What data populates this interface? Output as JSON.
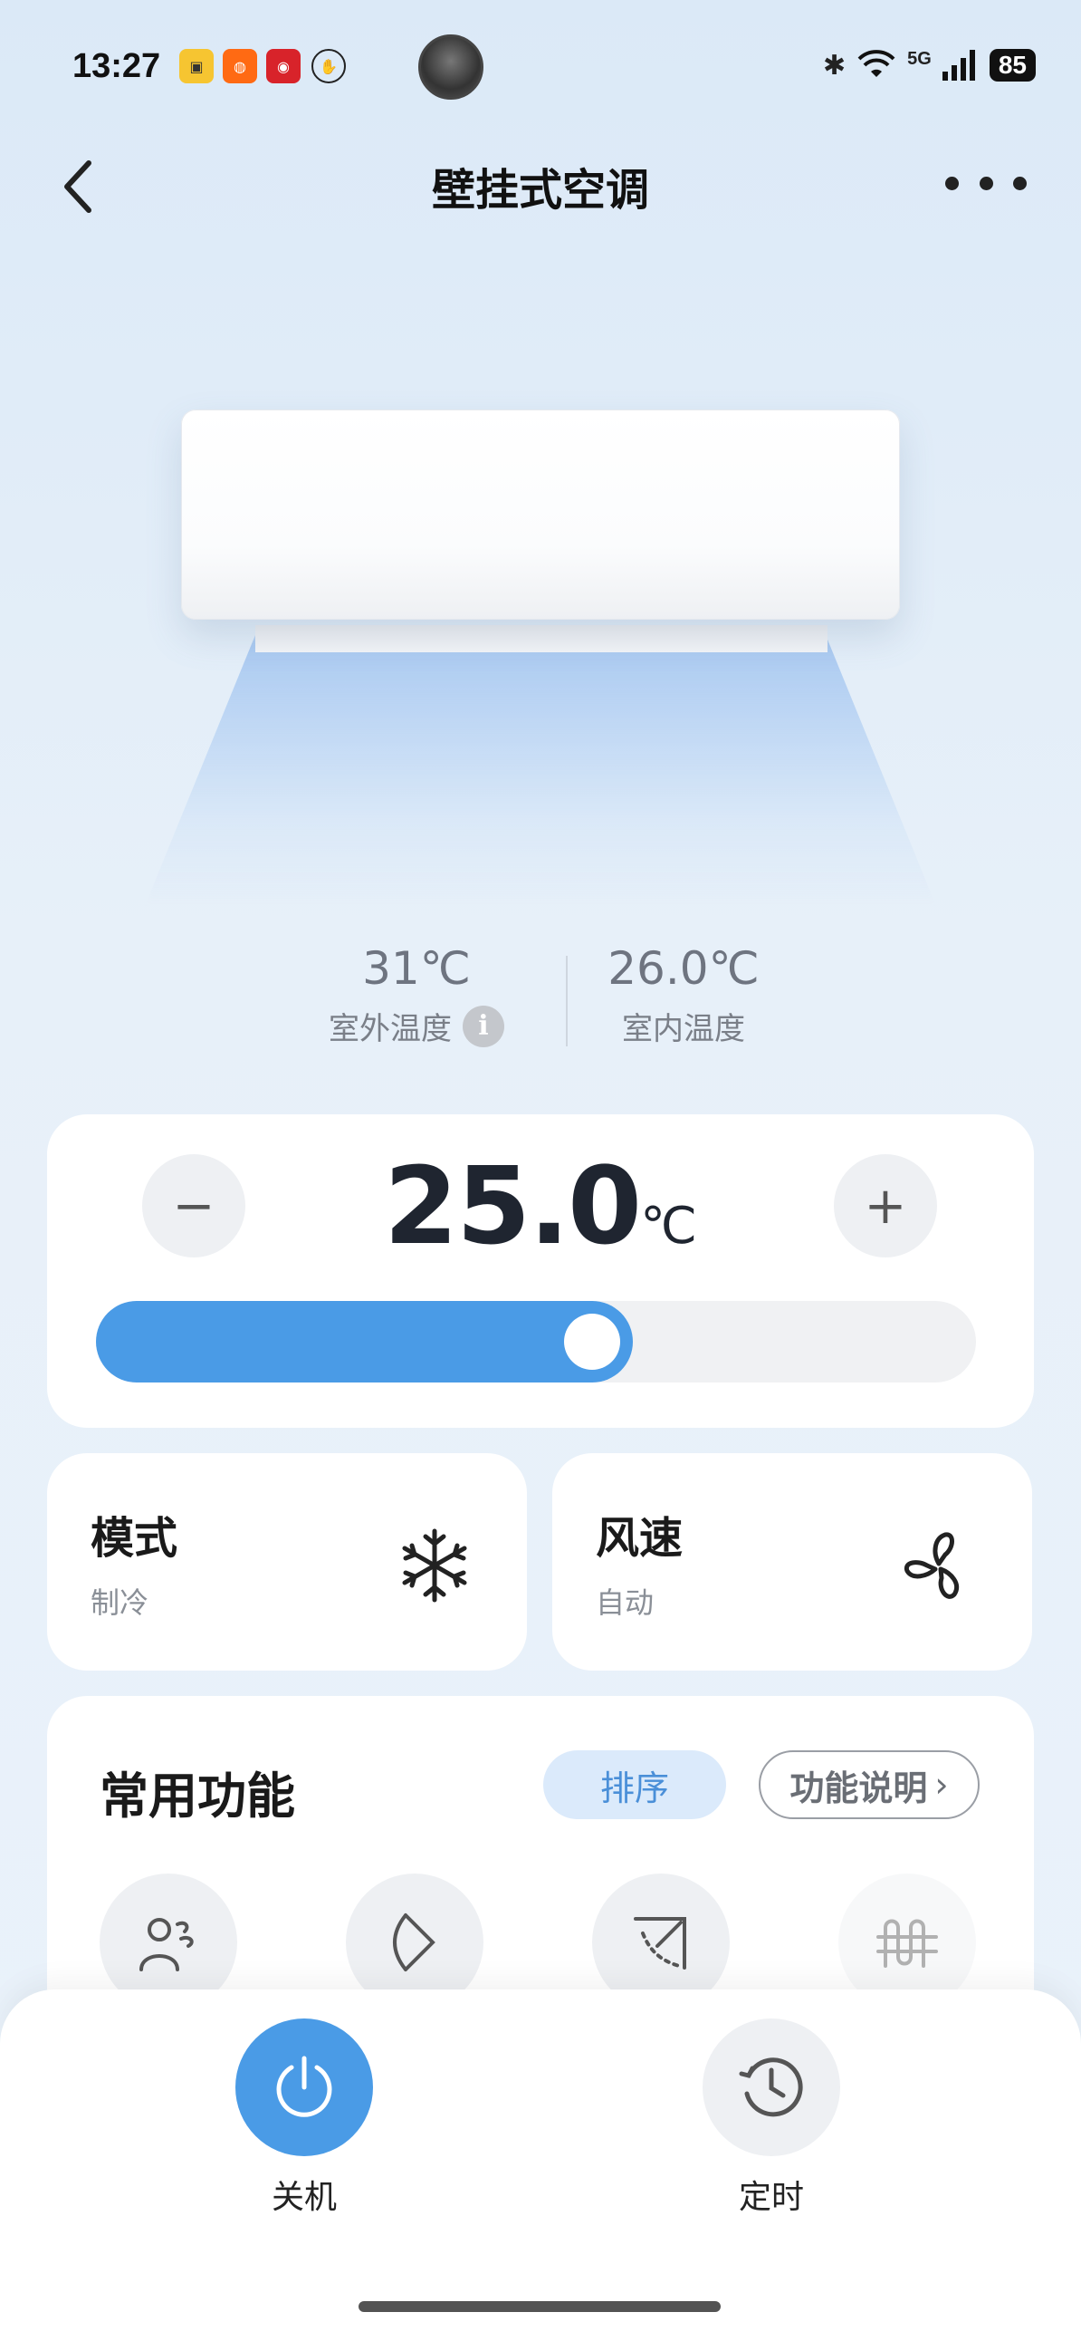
{
  "status_bar": {
    "time": "13:27",
    "network": "5G",
    "battery": "85"
  },
  "header": {
    "title": "壁挂式空调"
  },
  "readings": {
    "outdoor_value": "31℃",
    "outdoor_label": "室外温度",
    "indoor_value": "26.0℃",
    "indoor_label": "室内温度"
  },
  "setpoint": {
    "value": "25.0",
    "unit": "℃",
    "minus_label": "−",
    "plus_label": "+",
    "slider_fraction": 0.61
  },
  "mode": {
    "title": "模式",
    "value": "制冷",
    "icon": "snowflake-icon"
  },
  "fan": {
    "title": "风速",
    "value": "自动",
    "icon": "fan-icon"
  },
  "functions": {
    "title": "常用功能",
    "sort_label": "排序",
    "help_label": "功能说明",
    "items": [
      {
        "icon": "person-wind-icon"
      },
      {
        "icon": "swing-icon"
      },
      {
        "icon": "vent-direction-icon"
      },
      {
        "icon": "heater-icon"
      }
    ]
  },
  "bottom": {
    "power_label": "关机",
    "timer_label": "定时"
  },
  "colors": {
    "accent": "#4a9be6",
    "background": "#e7f0f9"
  }
}
